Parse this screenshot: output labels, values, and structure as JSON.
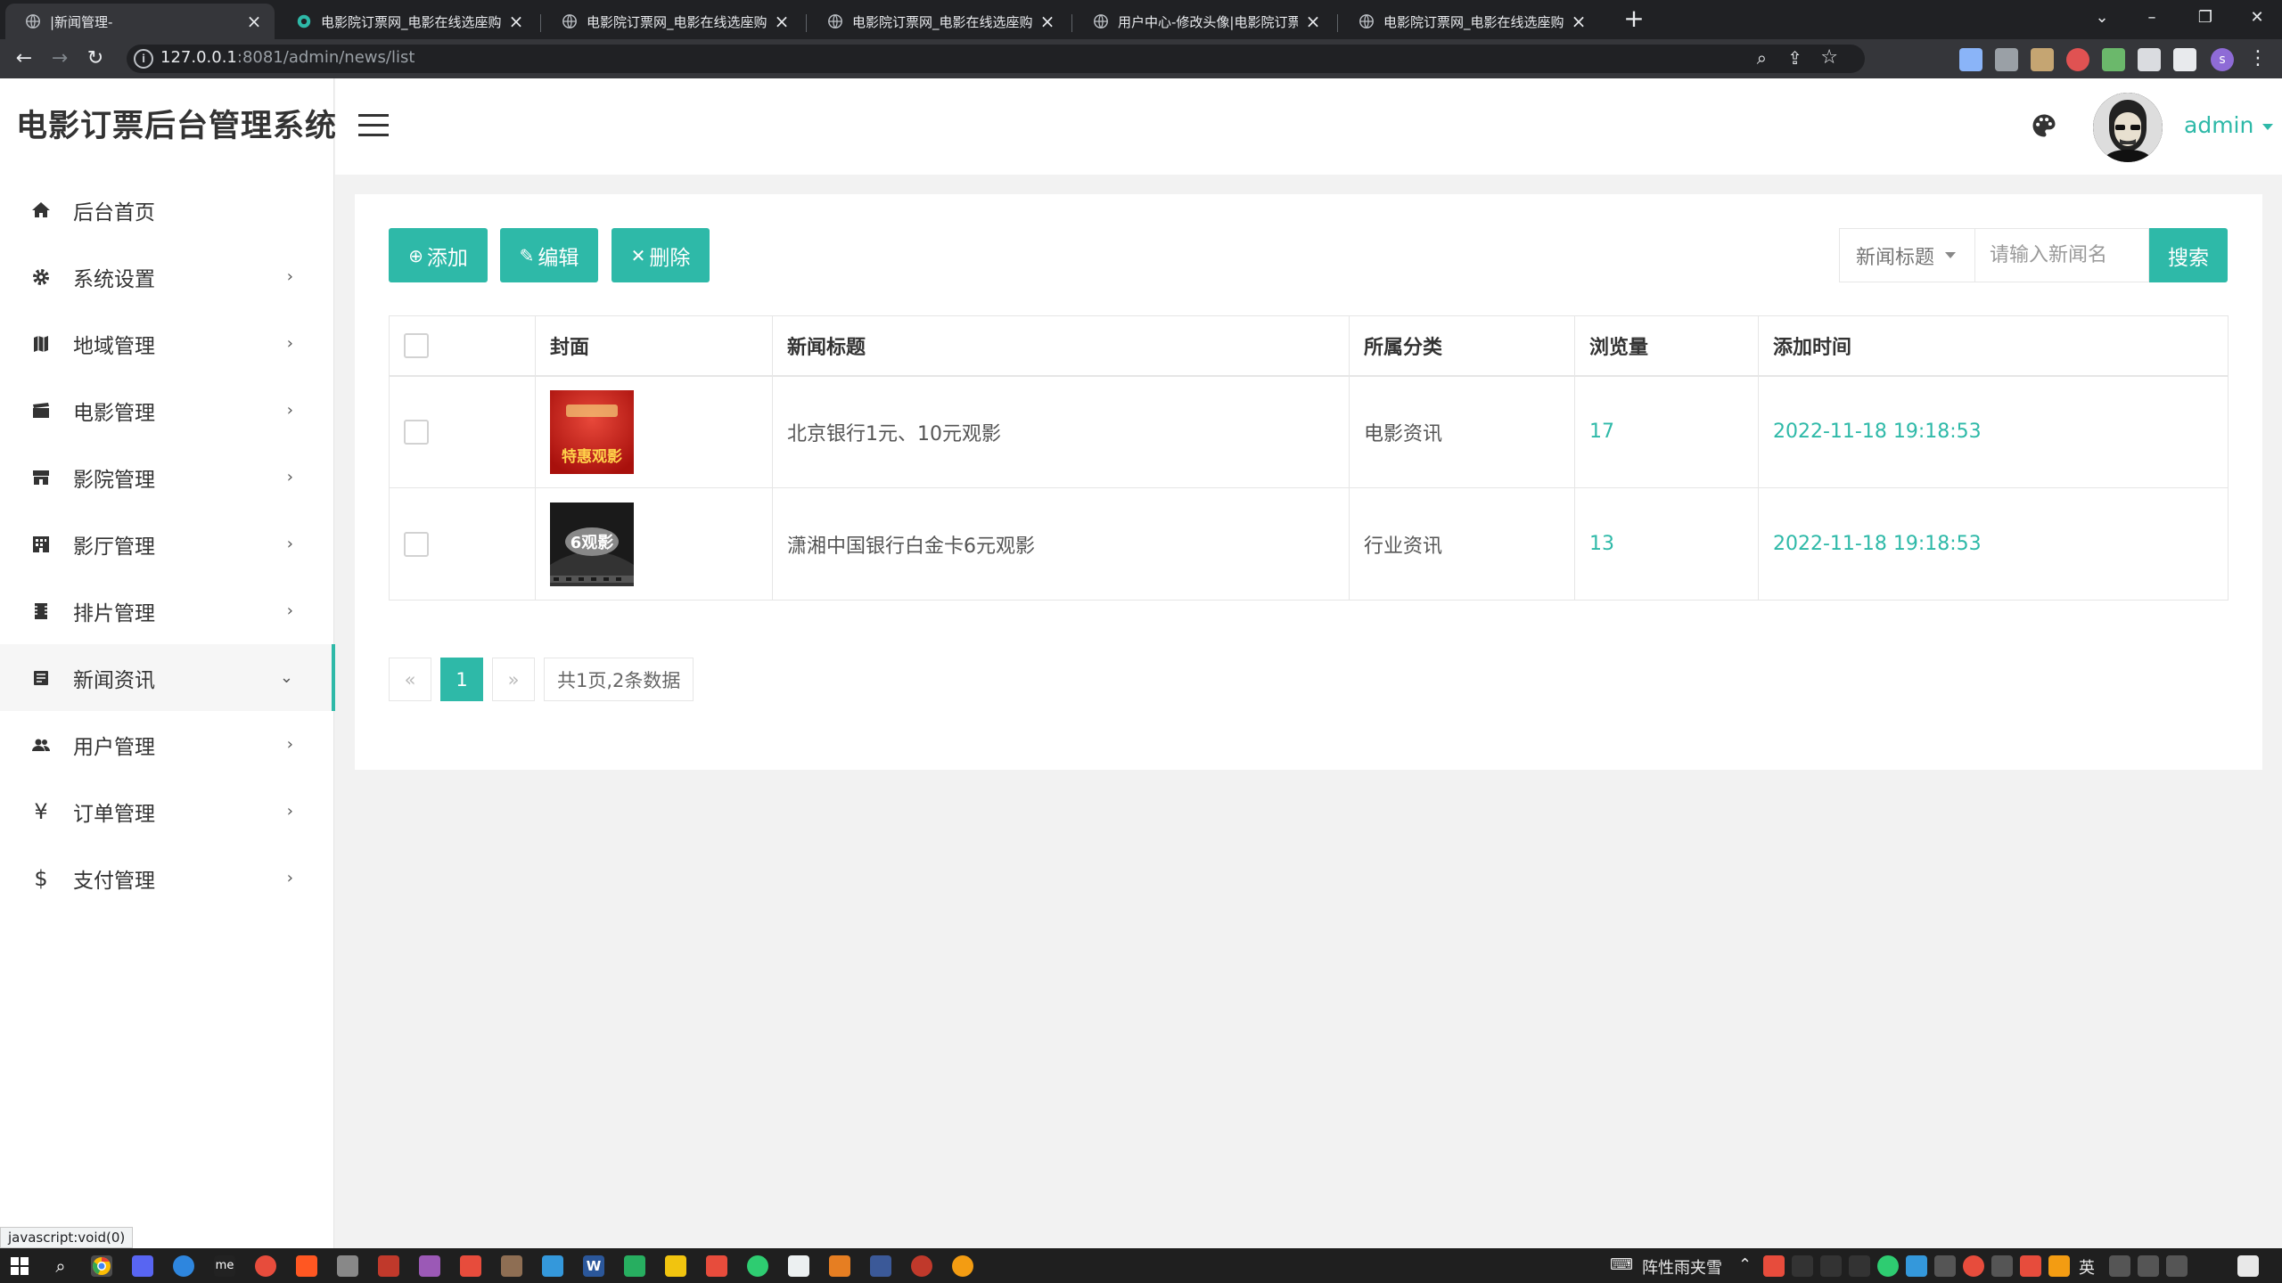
{
  "browser": {
    "tabs": [
      {
        "title": "|新闻管理-",
        "active": true
      },
      {
        "title": "电影院订票网_电影在线选座购票",
        "active": false
      },
      {
        "title": "电影院订票网_电影在线选座购票",
        "active": false
      },
      {
        "title": "电影院订票网_电影在线选座购票",
        "active": false
      },
      {
        "title": "用户中心-修改头像|电影院订票网",
        "active": false
      },
      {
        "title": "电影院订票网_电影在线选座购票",
        "active": false
      }
    ],
    "url_host": "127.0.0.1",
    "url_rest": ":8081/admin/news/list",
    "profile_initial": "s",
    "status_tip": "javascript:void(0)"
  },
  "app": {
    "logo": "电影订票后台管理系统",
    "username": "admin",
    "accent": "#2eb9a8",
    "menu": [
      {
        "label": "后台首页",
        "icon": "home-icon",
        "arrow": ""
      },
      {
        "label": "系统设置",
        "icon": "gear-icon",
        "arrow": "›"
      },
      {
        "label": "地域管理",
        "icon": "map-icon",
        "arrow": "›"
      },
      {
        "label": "电影管理",
        "icon": "film-icon",
        "arrow": "›"
      },
      {
        "label": "影院管理",
        "icon": "cinema-icon",
        "arrow": "›"
      },
      {
        "label": "影厅管理",
        "icon": "building-icon",
        "arrow": "›"
      },
      {
        "label": "排片管理",
        "icon": "schedule-icon",
        "arrow": "›"
      },
      {
        "label": "新闻资讯",
        "icon": "news-icon",
        "arrow": "⌄",
        "active": true
      },
      {
        "label": "用户管理",
        "icon": "users-icon",
        "arrow": "›"
      },
      {
        "label": "订单管理",
        "icon": "yen-icon",
        "arrow": "›"
      },
      {
        "label": "支付管理",
        "icon": "dollar-icon",
        "arrow": "›"
      }
    ],
    "toolbar": {
      "add_label": "添加",
      "edit_label": "编辑",
      "delete_label": "删除"
    },
    "search": {
      "field_select": "新闻标题",
      "placeholder": "请输入新闻名",
      "button": "搜索"
    },
    "table": {
      "columns": [
        "封面",
        "新闻标题",
        "所属分类",
        "浏览量",
        "添加时间"
      ],
      "rows": [
        {
          "title": "北京银行1元、10元观影",
          "category": "电影资讯",
          "views": "17",
          "added": "2022-11-18 19:18:53",
          "cover_text": "特惠观影"
        },
        {
          "title": "潇湘中国银行白金卡6元观影",
          "category": "行业资讯",
          "views": "13",
          "added": "2022-11-18 19:18:53",
          "cover_text": "6观影"
        }
      ]
    },
    "pagination": {
      "prev": "«",
      "current": "1",
      "next": "»",
      "summary": "共1页,2条数据"
    }
  },
  "taskbar": {
    "weather": "阵性雨夹雪",
    "ime": "英"
  }
}
